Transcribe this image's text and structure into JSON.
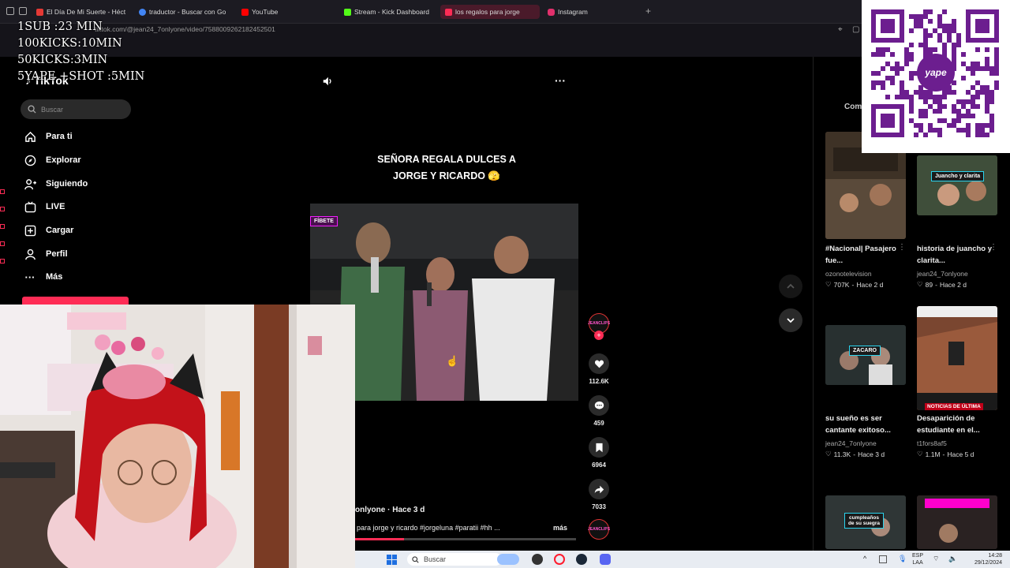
{
  "browser": {
    "tabs": [
      {
        "label": "El Día De Mi Suerte - Héct",
        "color": "#e53935"
      },
      {
        "label": "traductor - Buscar con Go",
        "color": "#4285f4"
      },
      {
        "label": "YouTube",
        "color": "#ff0000"
      },
      {
        "label": "Stream - Kick Dashboard",
        "color": "#53fc18"
      },
      {
        "label": "los regalos para jorge",
        "color": "#fe2c55"
      },
      {
        "label": "Instagram",
        "color": "#e1306c"
      }
    ],
    "new_tab": "+",
    "url": "tiktok.com/@jean24_7onlyone/video/7588009262182452501"
  },
  "overlay": {
    "lines": [
      "1SUB :23 MIN",
      "100KICKS:10MIN",
      "50KICKS:3MIN",
      "5YAPE +SHOT :5MIN"
    ]
  },
  "tiktok": {
    "logo": "TikTok",
    "search_placeholder": "Buscar",
    "nav": [
      {
        "label": "Para ti",
        "icon": "home-icon"
      },
      {
        "label": "Explorar",
        "icon": "compass-icon"
      },
      {
        "label": "Siguiendo",
        "icon": "following-icon"
      },
      {
        "label": "LIVE",
        "icon": "live-icon"
      },
      {
        "label": "Cargar",
        "icon": "upload-icon"
      },
      {
        "label": "Perfil",
        "icon": "profile-icon"
      },
      {
        "label": "Más",
        "icon": "more-icon"
      }
    ]
  },
  "video": {
    "title_line1": "SEÑORA REGALA DULCES A",
    "title_line2": "JORGE Y RICARDO 🫣",
    "tag_left": "FÍBETE",
    "author": "onlyone · Hace 3 d",
    "description": "para jorge y ricardo #jorgeluna #paratii #hh ...",
    "more": "más",
    "likes": "112.6K",
    "comments": "459",
    "saves": "6964",
    "shares": "7033",
    "channel_badge": "JEANCLIPS",
    "progress": 0.22
  },
  "right": {
    "header": "Com",
    "items": [
      {
        "caption": "#Nacional| Pasajero fue...",
        "author": "ozonotelevision",
        "likes": "707K",
        "age": "Hace 2 d",
        "overlay": ""
      },
      {
        "caption": "historia de juancho y clarita...",
        "author": "jean24_7onlyone",
        "likes": "89",
        "age": "Hace 2 d",
        "overlay": "Juancho y clarita"
      },
      {
        "caption": "su sueño es ser cantante exitoso...",
        "author": "jean24_7onlyone",
        "likes": "11.3K",
        "age": "Hace 3 d",
        "overlay": "ZACARO"
      },
      {
        "caption": "Desaparición de estudiante en el...",
        "author": "t1fors8af5",
        "likes": "1.1M",
        "age": "Hace 5 d",
        "overlay": "NOTICIAS DE ÚLTIMA"
      },
      {
        "caption": "",
        "author": "",
        "likes": "",
        "age": "",
        "overlay": "cumpleaños de su suegra"
      },
      {
        "caption": "",
        "author": "",
        "likes": "",
        "age": "",
        "overlay": ""
      }
    ]
  },
  "qr": {
    "brand": "yape"
  },
  "taskbar": {
    "search": "Buscar",
    "lang_top": "ESP",
    "lang_bottom": "LAA",
    "time": "14:28",
    "date": "29/12/2024"
  }
}
